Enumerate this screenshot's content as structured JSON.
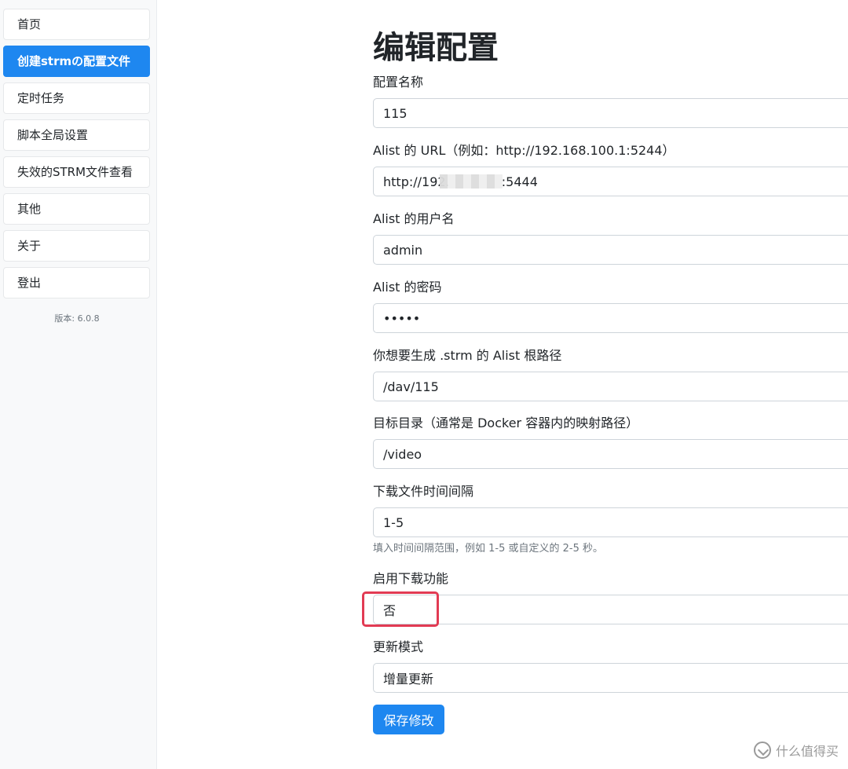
{
  "sidebar": {
    "items": [
      {
        "label": "首页"
      },
      {
        "label": "创建strmの配置文件",
        "active": true
      },
      {
        "label": "定时任务"
      },
      {
        "label": "脚本全局设置"
      },
      {
        "label": "失效的STRM文件查看"
      },
      {
        "label": "其他"
      },
      {
        "label": "关于"
      },
      {
        "label": "登出"
      }
    ],
    "version": "版本: 6.0.8"
  },
  "main": {
    "title": "编辑配置",
    "fields": {
      "config_name": {
        "label": "配置名称",
        "value": "115"
      },
      "alist_url": {
        "label": "Alist 的 URL（例如：http://192.168.100.1:5244）",
        "value": "http://192.             :5444"
      },
      "alist_username": {
        "label": "Alist 的用户名",
        "value": "admin"
      },
      "alist_password": {
        "label": "Alist 的密码",
        "value": "•••••"
      },
      "alist_root_path": {
        "label": "你想要生成 .strm 的 Alist 根路径",
        "value": "/dav/115"
      },
      "target_dir": {
        "label": "目标目录（通常是 Docker 容器内的映射路径）",
        "value": "/video"
      },
      "download_interval": {
        "label": "下载文件时间间隔",
        "value": "1-5",
        "help": "填入时间间隔范围，例如 1-5 或自定义的 2-5 秒。"
      },
      "enable_download": {
        "label": "启用下载功能",
        "value": "否"
      },
      "update_mode": {
        "label": "更新模式",
        "value": "增量更新"
      }
    },
    "save_label": "保存修改"
  },
  "watermark": {
    "text": "什么值得买"
  },
  "colors": {
    "primary": "#1e87f0",
    "highlight": "#e23b53"
  }
}
